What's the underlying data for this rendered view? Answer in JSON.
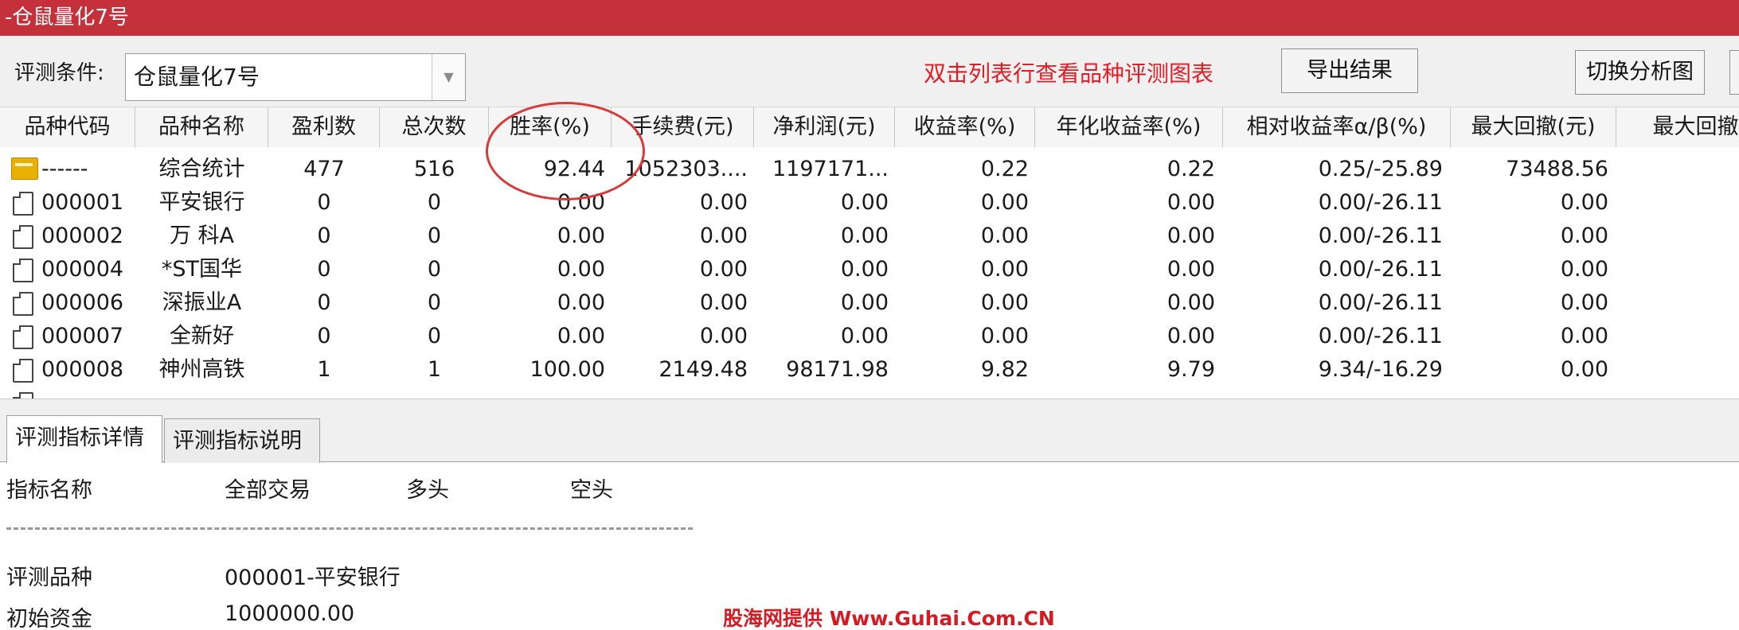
{
  "window": {
    "title": "-仓鼠量化7号"
  },
  "toolbar": {
    "condition_label": "评测条件:",
    "condition_value": "仓鼠量化7号",
    "hint": "双击列表行查看品种评测图表",
    "export_button": "导出结果",
    "switch_button": "切换分析图"
  },
  "table": {
    "columns": [
      "品种代码",
      "品种名称",
      "盈利数",
      "总次数",
      "胜率(%)",
      "手续费(元)",
      "净利润(元)",
      "收益率(%)",
      "年化收益率(%)",
      "相对收益率α/β(%)",
      "最大回撤(元)",
      "最大回撤"
    ],
    "rows": [
      {
        "code": "------",
        "name": "综合统计",
        "profit_count": "477",
        "total": "516",
        "win_rate": "92.44",
        "fee": "1052303....",
        "net_profit": "1197171...",
        "return": "0.22",
        "annual_return": "0.22",
        "alpha_beta": "0.25/-25.89",
        "max_drawdown": "73488.56",
        "icon": "folder-icon"
      },
      {
        "code": "000001",
        "name": "平安银行",
        "profit_count": "0",
        "total": "0",
        "win_rate": "0.00",
        "fee": "0.00",
        "net_profit": "0.00",
        "return": "0.00",
        "annual_return": "0.00",
        "alpha_beta": "0.00/-26.11",
        "max_drawdown": "0.00",
        "icon": "document-icon"
      },
      {
        "code": "000002",
        "name": "万 科A",
        "profit_count": "0",
        "total": "0",
        "win_rate": "0.00",
        "fee": "0.00",
        "net_profit": "0.00",
        "return": "0.00",
        "annual_return": "0.00",
        "alpha_beta": "0.00/-26.11",
        "max_drawdown": "0.00",
        "icon": "document-icon"
      },
      {
        "code": "000004",
        "name": "*ST国华",
        "profit_count": "0",
        "total": "0",
        "win_rate": "0.00",
        "fee": "0.00",
        "net_profit": "0.00",
        "return": "0.00",
        "annual_return": "0.00",
        "alpha_beta": "0.00/-26.11",
        "max_drawdown": "0.00",
        "icon": "document-icon"
      },
      {
        "code": "000006",
        "name": "深振业A",
        "profit_count": "0",
        "total": "0",
        "win_rate": "0.00",
        "fee": "0.00",
        "net_profit": "0.00",
        "return": "0.00",
        "annual_return": "0.00",
        "alpha_beta": "0.00/-26.11",
        "max_drawdown": "0.00",
        "icon": "document-icon"
      },
      {
        "code": "000007",
        "name": "全新好",
        "profit_count": "0",
        "total": "0",
        "win_rate": "0.00",
        "fee": "0.00",
        "net_profit": "0.00",
        "return": "0.00",
        "annual_return": "0.00",
        "alpha_beta": "0.00/-26.11",
        "max_drawdown": "0.00",
        "icon": "document-icon"
      },
      {
        "code": "000008",
        "name": "神州高铁",
        "profit_count": "1",
        "total": "1",
        "win_rate": "100.00",
        "fee": "2149.48",
        "net_profit": "98171.98",
        "return": "9.82",
        "annual_return": "9.79",
        "alpha_beta": "9.34/-16.29",
        "max_drawdown": "0.00",
        "icon": "document-icon"
      }
    ]
  },
  "tabs": [
    "评测指标详情",
    "评测指标说明"
  ],
  "details": {
    "header": [
      "指标名称",
      "全部交易",
      "多头",
      "空头"
    ],
    "lines": [
      {
        "label": "评测品种",
        "value": "000001-平安银行"
      },
      {
        "label": "初始资金",
        "value": "1000000.00"
      }
    ]
  },
  "watermark": "股海网提供 Www.Guhai.Com.CN"
}
